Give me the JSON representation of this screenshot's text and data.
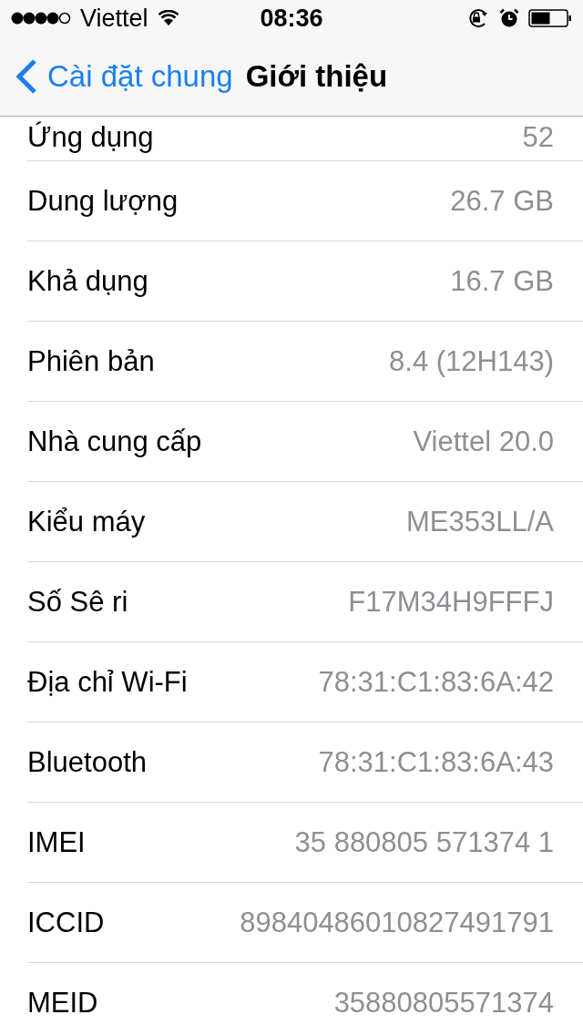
{
  "status_bar": {
    "carrier": "Viettel",
    "time": "08:36"
  },
  "nav_bar": {
    "back_label": "Cài đặt chung",
    "title": "Giới thiệu"
  },
  "rows": [
    {
      "label": "Ứng dụng",
      "value": "52"
    },
    {
      "label": "Dung lượng",
      "value": "26.7 GB"
    },
    {
      "label": "Khả dụng",
      "value": "16.7 GB"
    },
    {
      "label": "Phiên bản",
      "value": "8.4 (12H143)"
    },
    {
      "label": "Nhà cung cấp",
      "value": "Viettel 20.0"
    },
    {
      "label": "Kiểu máy",
      "value": "ME353LL/A"
    },
    {
      "label": "Số Sê ri",
      "value": "F17M34H9FFFJ"
    },
    {
      "label": "Địa chỉ Wi-Fi",
      "value": "78:31:C1:83:6A:42"
    },
    {
      "label": "Bluetooth",
      "value": "78:31:C1:83:6A:43"
    },
    {
      "label": "IMEI",
      "value": "35 880805 571374 1"
    },
    {
      "label": "ICCID",
      "value": "89840486010827491791"
    },
    {
      "label": "MEID",
      "value": "35880805571374"
    }
  ]
}
